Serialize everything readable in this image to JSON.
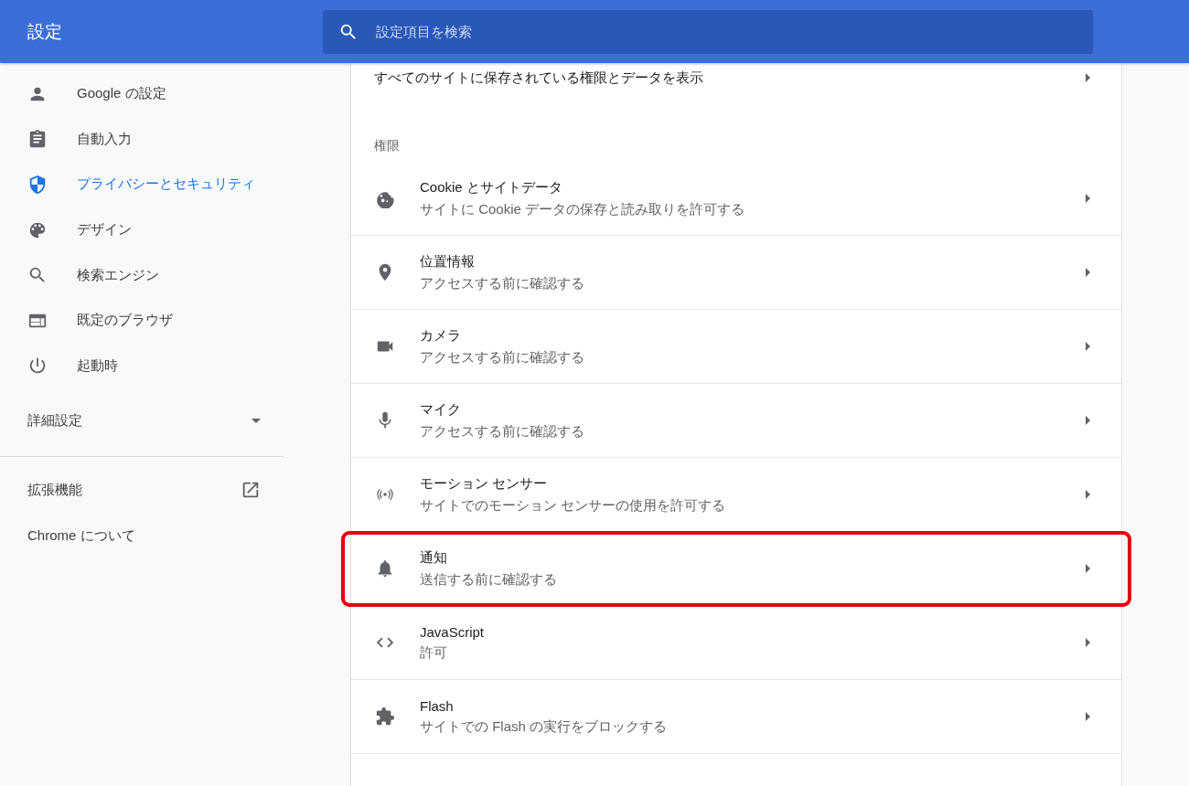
{
  "header": {
    "title": "設定",
    "search": {
      "placeholder": "設定項目を検索"
    }
  },
  "sidebar": {
    "items": [
      {
        "label": "Google の設定",
        "selected": false
      },
      {
        "label": "自動入力",
        "selected": false
      },
      {
        "label": "プライバシーとセキュリティ",
        "selected": true
      },
      {
        "label": "デザイン",
        "selected": false
      },
      {
        "label": "検索エンジン",
        "selected": false
      },
      {
        "label": "既定のブラウザ",
        "selected": false
      },
      {
        "label": "起動時",
        "selected": false
      }
    ],
    "advanced": {
      "label": "詳細設定",
      "expanded": false
    },
    "extensions": {
      "label": "拡張機能"
    },
    "about": {
      "label": "Chrome について"
    }
  },
  "main": {
    "all_sites": {
      "label": "すべてのサイトに保存されている権限とデータを表示"
    },
    "section_title": "権限",
    "rows": [
      {
        "title": "Cookie とサイトデータ",
        "subtitle": "サイトに Cookie データの保存と読み取りを許可する",
        "highlighted": false
      },
      {
        "title": "位置情報",
        "subtitle": "アクセスする前に確認する",
        "highlighted": false
      },
      {
        "title": "カメラ",
        "subtitle": "アクセスする前に確認する",
        "highlighted": false
      },
      {
        "title": "マイク",
        "subtitle": "アクセスする前に確認する",
        "highlighted": false
      },
      {
        "title": "モーション センサー",
        "subtitle": "サイトでのモーション センサーの使用を許可する",
        "highlighted": false
      },
      {
        "title": "通知",
        "subtitle": "送信する前に確認する",
        "highlighted": true
      },
      {
        "title": "JavaScript",
        "subtitle": "許可",
        "highlighted": false
      },
      {
        "title": "Flash",
        "subtitle": "サイトでの Flash の実行をブロックする",
        "highlighted": false
      }
    ]
  }
}
